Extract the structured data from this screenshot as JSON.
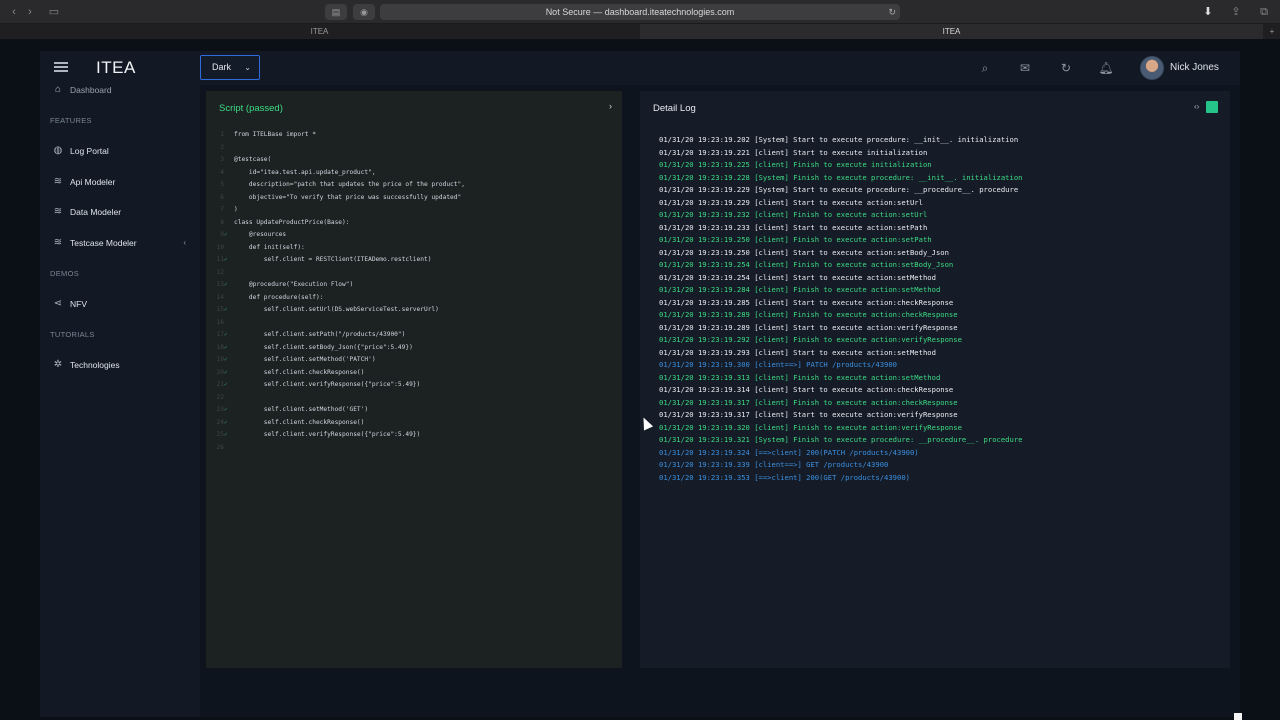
{
  "browser": {
    "url": "Not Secure — dashboard.iteatechnologies.com",
    "tabs": [
      "ITEA",
      "ITEA"
    ]
  },
  "app": {
    "brand": "ITEA",
    "theme": "Dark",
    "user_name": "Nick Jones"
  },
  "sidebar": {
    "dashboard": "Dashboard",
    "sections": {
      "features": "FEATURES",
      "demos": "DEMOS",
      "tutorials": "TUTORIALS"
    },
    "items": [
      {
        "label": "Log Portal",
        "icon": "globe-icon"
      },
      {
        "label": "Api Modeler",
        "icon": "layers-icon"
      },
      {
        "label": "Data Modeler",
        "icon": "layers-icon"
      },
      {
        "label": "Testcase Modeler",
        "icon": "layers-icon"
      },
      {
        "label": "NFV",
        "icon": "share-icon"
      },
      {
        "label": "Technologies",
        "icon": "gear-icon"
      }
    ]
  },
  "script": {
    "title": "Script (passed)",
    "lines": [
      {
        "n": "1",
        "c": false,
        "text": "from ITELBase import *"
      },
      {
        "n": "2",
        "c": false,
        "text": ""
      },
      {
        "n": "3",
        "c": false,
        "text": "@testcase("
      },
      {
        "n": "4",
        "c": false,
        "text": "    id=\"itea.test.api.update_product\","
      },
      {
        "n": "5",
        "c": false,
        "text": "    description=\"patch that updates the price of the product\","
      },
      {
        "n": "6",
        "c": false,
        "text": "    objective=\"To verify that price was successfully updated\""
      },
      {
        "n": "7",
        "c": false,
        "text": ")"
      },
      {
        "n": "8",
        "c": false,
        "text": "class UpdateProductPrice(Base):"
      },
      {
        "n": "9",
        "c": true,
        "text": "    @resources"
      },
      {
        "n": "10",
        "c": false,
        "text": "    def init(self):"
      },
      {
        "n": "11",
        "c": true,
        "text": "        self.client = RESTClient(ITEADemo.restclient)"
      },
      {
        "n": "12",
        "c": false,
        "text": ""
      },
      {
        "n": "13",
        "c": true,
        "text": "    @procedure(\"Execution Flow\")"
      },
      {
        "n": "14",
        "c": false,
        "text": "    def procedure(self):"
      },
      {
        "n": "15",
        "c": true,
        "text": "        self.client.setUrl(DS.webServiceTest.serverUrl)"
      },
      {
        "n": "16",
        "c": false,
        "text": ""
      },
      {
        "n": "17",
        "c": true,
        "text": "        self.client.setPath(\"/products/43900\")"
      },
      {
        "n": "18",
        "c": true,
        "text": "        self.client.setBody_Json({\"price\":5.49})"
      },
      {
        "n": "19",
        "c": true,
        "text": "        self.client.setMethod('PATCH')"
      },
      {
        "n": "20",
        "c": true,
        "text": "        self.client.checkResponse()"
      },
      {
        "n": "21",
        "c": true,
        "text": "        self.client.verifyResponse({\"price\":5.49})"
      },
      {
        "n": "22",
        "c": false,
        "text": ""
      },
      {
        "n": "23",
        "c": true,
        "text": "        self.client.setMethod('GET')"
      },
      {
        "n": "24",
        "c": true,
        "text": "        self.client.checkResponse()"
      },
      {
        "n": "25",
        "c": true,
        "text": "        self.client.verifyResponse({\"price\":5.49})"
      },
      {
        "n": "26",
        "c": false,
        "text": ""
      }
    ]
  },
  "log": {
    "title": "Detail Log",
    "lines": [
      {
        "t": "01/31/20 19:23:19.202 [System] Start to execute procedure: __init__. initialization",
        "k": "white"
      },
      {
        "t": "01/31/20 19:23:19.221 [client] Start to execute initialization",
        "k": "white"
      },
      {
        "t": "01/31/20 19:23:19.225 [client] Finish to execute initialization",
        "k": "green"
      },
      {
        "t": "01/31/20 19:23:19.228 [System] Finish to execute procedure: __init__. initialization",
        "k": "green"
      },
      {
        "t": "01/31/20 19:23:19.229 [System] Start to execute procedure: __procedure__. procedure",
        "k": "white"
      },
      {
        "t": "01/31/20 19:23:19.229 [client] Start to execute action:setUrl",
        "k": "white"
      },
      {
        "t": "01/31/20 19:23:19.232 [client] Finish to execute action:setUrl",
        "k": "green"
      },
      {
        "t": "01/31/20 19:23:19.233 [client] Start to execute action:setPath",
        "k": "white"
      },
      {
        "t": "01/31/20 19:23:19.250 [client] Finish to execute action:setPath",
        "k": "green"
      },
      {
        "t": "01/31/20 19:23:19.250 [client] Start to execute action:setBody_Json",
        "k": "white"
      },
      {
        "t": "01/31/20 19:23:19.254 [client] Finish to execute action:setBody_Json",
        "k": "green"
      },
      {
        "t": "01/31/20 19:23:19.254 [client] Start to execute action:setMethod",
        "k": "white"
      },
      {
        "t": "01/31/20 19:23:19.284 [client] Finish to execute action:setMethod",
        "k": "green"
      },
      {
        "t": "01/31/20 19:23:19.285 [client] Start to execute action:checkResponse",
        "k": "white"
      },
      {
        "t": "01/31/20 19:23:19.289 [client] Finish to execute action:checkResponse",
        "k": "green"
      },
      {
        "t": "01/31/20 19:23:19.289 [client] Start to execute action:verifyResponse",
        "k": "white"
      },
      {
        "t": "01/31/20 19:23:19.292 [client] Finish to execute action:verifyResponse",
        "k": "green"
      },
      {
        "t": "01/31/20 19:23:19.293 [client] Start to execute action:setMethod",
        "k": "white"
      },
      {
        "t": "01/31/20 19:23:19.300 [client==>] PATCH /products/43900",
        "k": "blue"
      },
      {
        "t": "01/31/20 19:23:19.313 [client] Finish to execute action:setMethod",
        "k": "green"
      },
      {
        "t": "01/31/20 19:23:19.314 [client] Start to execute action:checkResponse",
        "k": "white"
      },
      {
        "t": "01/31/20 19:23:19.317 [client] Finish to execute action:checkResponse",
        "k": "green"
      },
      {
        "t": "01/31/20 19:23:19.317 [client] Start to execute action:verifyResponse",
        "k": "white"
      },
      {
        "t": "01/31/20 19:23:19.320 [client] Finish to execute action:verifyResponse",
        "k": "green"
      },
      {
        "t": "01/31/20 19:23:19.321 [System] Finish to execute procedure: __procedure__. procedure",
        "k": "green"
      },
      {
        "t": "01/31/20 19:23:19.324 [==>client] 200(PATCH /products/43900)",
        "k": "blue"
      },
      {
        "t": "01/31/20 19:23:19.339 [client==>] GET /products/43900",
        "k": "blue"
      },
      {
        "t": "01/31/20 19:23:19.353 [==>client] 200(GET /products/43900)",
        "k": "blue"
      }
    ]
  },
  "colors": {
    "accent_green": "#3ddc84",
    "accent_blue": "#3b8fe0",
    "select_border": "#2d6cdf"
  }
}
